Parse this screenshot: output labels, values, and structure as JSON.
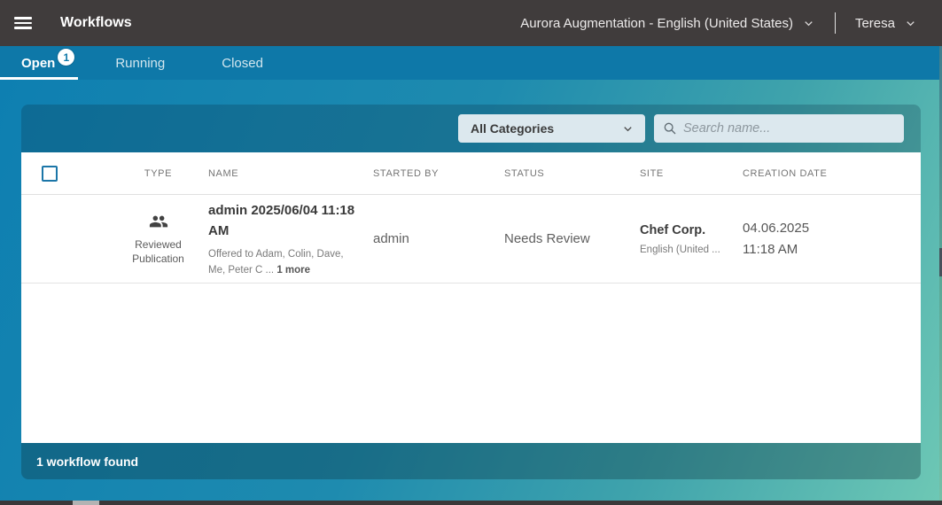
{
  "topbar": {
    "title": "Workflows",
    "language_selector": "Aurora Augmentation - English (United States)",
    "user": "Teresa"
  },
  "tabs": [
    {
      "label": "Open",
      "badge": "1",
      "active": true
    },
    {
      "label": "Running",
      "active": false
    },
    {
      "label": "Closed",
      "active": false
    }
  ],
  "filters": {
    "category_dropdown_value": "All Categories",
    "search_placeholder": "Search name..."
  },
  "table": {
    "columns": [
      "TYPE",
      "NAME",
      "STARTED BY",
      "STATUS",
      "SITE",
      "CREATION DATE"
    ],
    "rows": [
      {
        "type_icon": "people-icon",
        "type_label": "Reviewed Publication",
        "name": "admin 2025/06/04 11:18 AM",
        "name_sub": "Offered to Adam, Colin, Dave, Me, Peter C ...",
        "name_sub_more": "1 more",
        "started_by": "admin",
        "status": "Needs Review",
        "site": "Chef Corp.",
        "site_sub": "English (United ...",
        "creation_date": "04.06.2025",
        "creation_time": "11:18 AM"
      }
    ]
  },
  "footer": {
    "summary": "1 workflow found"
  },
  "colors": {
    "topbar_bg": "#403C3C",
    "tabbar_bg": "#0E78A8",
    "gradient_start": "#0E7FB1",
    "gradient_end": "#6EC8B5",
    "checkbox_border": "#1B76A8",
    "panel_field_bg": "#DCE8EE"
  }
}
